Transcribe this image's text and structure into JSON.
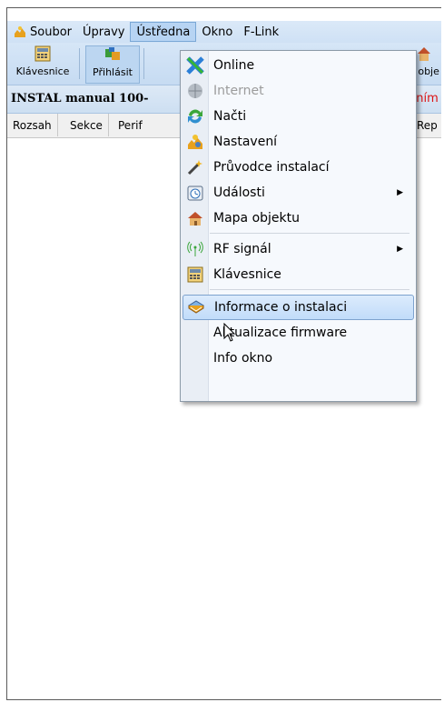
{
  "menubar": {
    "items": [
      "Soubor",
      "Úpravy",
      "Ústředna",
      "Okno",
      "F-Link"
    ],
    "active": "Ústředna"
  },
  "toolbar": {
    "buttons": [
      "Klávesnice",
      "Přihlásit",
      "a obje"
    ]
  },
  "title_strip": {
    "title": "INSTAL manual 100-",
    "warning_fragment": "dáním"
  },
  "tabs": [
    "Rozsah",
    "Sekce",
    "Perif",
    "Rep"
  ],
  "dropdown": {
    "items": [
      {
        "label": "Online",
        "icon": "online-icon"
      },
      {
        "label": "Internet",
        "icon": "internet-icon",
        "disabled": true
      },
      {
        "label": "Načti",
        "icon": "load-icon"
      },
      {
        "label": "Nastavení",
        "icon": "settings-icon"
      },
      {
        "label": "Průvodce instalací",
        "icon": "wizard-icon"
      },
      {
        "label": "Události",
        "icon": "events-icon",
        "submenu": true
      },
      {
        "label": "Mapa objektu",
        "icon": "house-icon"
      },
      {
        "label": "RF signál",
        "icon": "rf-signal-icon",
        "submenu": true
      },
      {
        "label": "Klávesnice",
        "icon": "keyboard-icon"
      },
      {
        "label": "Informace o instalaci",
        "icon": "info-book-icon",
        "highlighted": true
      },
      {
        "label": "Aktualizace firmware",
        "icon": ""
      },
      {
        "label": "Info okno",
        "icon": ""
      }
    ]
  },
  "colors": {
    "menubar_bg": "#cfe1f5",
    "highlight": "#c1dcfa",
    "warning_text": "#dd1111"
  }
}
